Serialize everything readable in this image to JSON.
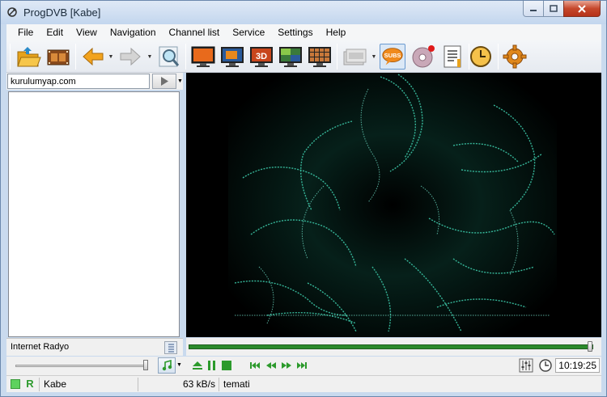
{
  "window": {
    "title": "ProgDVB [Kabe]"
  },
  "menu": [
    "File",
    "Edit",
    "View",
    "Navigation",
    "Channel list",
    "Service",
    "Settings",
    "Help"
  ],
  "search": {
    "value": "kurulumyap.com"
  },
  "channel_footer": {
    "name": "Internet Radyo"
  },
  "controls": {
    "time": "10:19:25",
    "progress_fraction": 1.0,
    "volume_fraction": 1.0
  },
  "status": {
    "channel": "Kabe",
    "bitrate": "63 kB/s",
    "info": "temati"
  },
  "colors": {
    "progress": "#2b8a2b",
    "video_glow": "#3fd1b0",
    "status_green": "#5ed25e"
  }
}
